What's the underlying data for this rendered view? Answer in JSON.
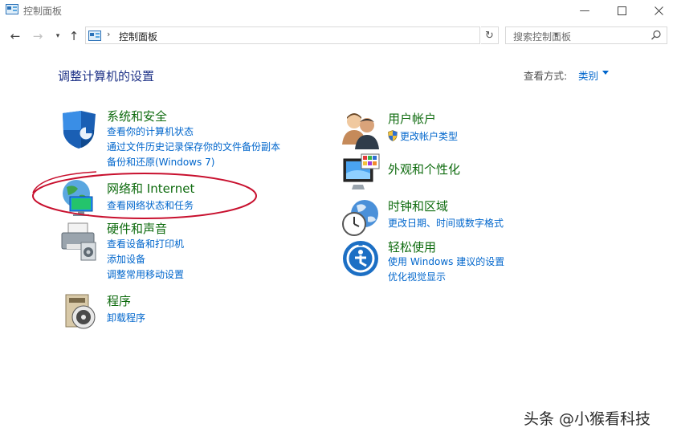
{
  "window": {
    "title": "控制面板"
  },
  "address": {
    "crumb": "控制面板",
    "separator": "›",
    "search_placeholder": "搜索控制面板"
  },
  "header": {
    "title": "调整计算机的设置",
    "view_by_label": "查看方式:",
    "view_by_value": "类别"
  },
  "categories": [
    {
      "title": "系统和安全",
      "icon": "security-shield-icon",
      "links": [
        "查看你的计算机状态",
        "通过文件历史记录保存你的文件备份副本",
        "备份和还原(Windows 7)"
      ]
    },
    {
      "title": "网络和 Internet",
      "icon": "network-globe-icon",
      "links": [
        "查看网络状态和任务"
      ]
    },
    {
      "title": "硬件和声音",
      "icon": "printer-icon",
      "links": [
        "查看设备和打印机",
        "添加设备",
        "调整常用移动设置"
      ]
    },
    {
      "title": "程序",
      "icon": "programs-disc-icon",
      "links": [
        "卸载程序"
      ]
    },
    {
      "title": "用户帐户",
      "icon": "users-icon",
      "links": [
        "更改帐户类型"
      ]
    },
    {
      "title": "外观和个性化",
      "icon": "monitor-palette-icon",
      "links": []
    },
    {
      "title": "时钟和区域",
      "icon": "clock-globe-icon",
      "links": [
        "更改日期、时间或数字格式"
      ]
    },
    {
      "title": "轻松使用",
      "icon": "ease-of-access-icon",
      "links": [
        "使用 Windows 建议的设置",
        "优化视觉显示"
      ]
    }
  ],
  "watermark": "头条 @小猴看科技",
  "colors": {
    "category_title": "#0e6b0e",
    "link": "#0066cc",
    "heading": "#1e3287",
    "highlight_ellipse": "#c8102e"
  }
}
